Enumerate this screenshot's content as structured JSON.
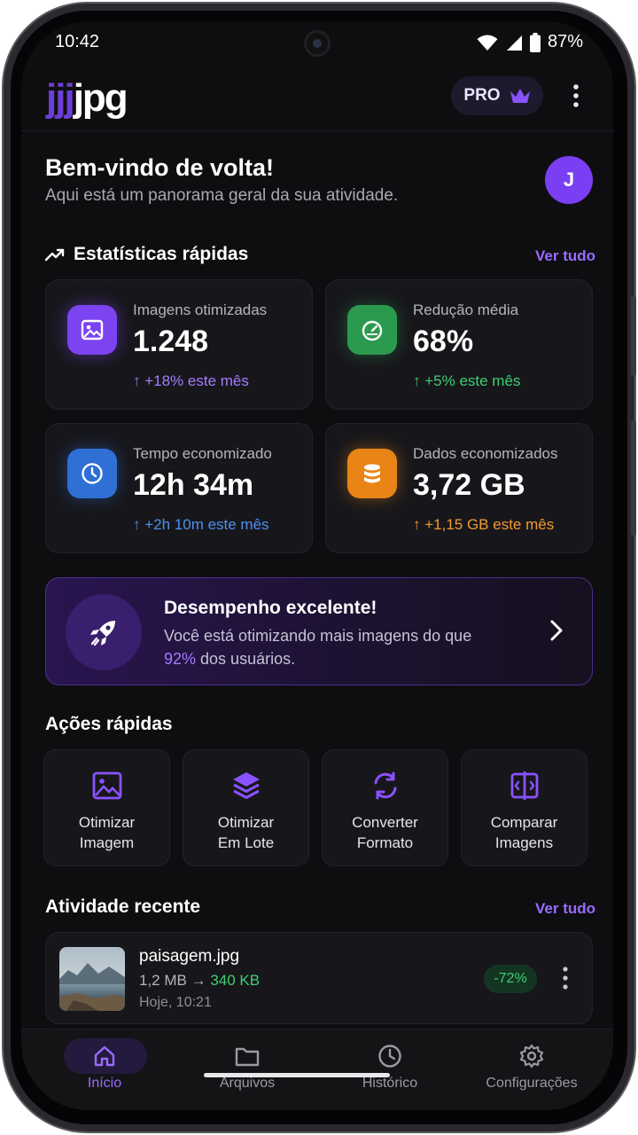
{
  "status": {
    "time": "10:42",
    "battery": "87%"
  },
  "header": {
    "logo_prefix": "jjj",
    "logo_suffix": "jpg",
    "pro_label": "PRO"
  },
  "welcome": {
    "title": "Bem-vindo de volta!",
    "subtitle": "Aqui está um panorama geral da sua atividade.",
    "avatar_initial": "J"
  },
  "quick_stats": {
    "title": "Estatísticas rápidas",
    "see_all": "Ver tudo",
    "cards": [
      {
        "label": "Imagens otimizadas",
        "value": "1.248",
        "trend": "↑ +18% este mês",
        "icon": "image-icon",
        "color": "#7b44f0",
        "trend_color": "#a67aff"
      },
      {
        "label": "Redução média",
        "value": "68%",
        "trend": "↑ +5% este mês",
        "icon": "speedometer-icon",
        "color": "#2c9a4e",
        "trend_color": "#3ecf72"
      },
      {
        "label": "Tempo economizado",
        "value": "12h 34m",
        "trend": "↑ +2h 10m este mês",
        "icon": "clock-icon",
        "color": "#2f6fd6",
        "trend_color": "#4f8ff0"
      },
      {
        "label": "Dados economizados",
        "value": "3,72 GB",
        "trend": "↑ +1,15 GB este mês",
        "icon": "database-icon",
        "color": "#e98416",
        "trend_color": "#f59a2f"
      }
    ]
  },
  "performance": {
    "title": "Desempenho excelente!",
    "desc_before": "Você está otimizando mais imagens do que ",
    "highlight": "92%",
    "desc_after": " dos usuários."
  },
  "quick_actions": {
    "title": "Ações rápidas",
    "items": [
      {
        "line1": "Otimizar",
        "line2": "Imagem",
        "icon": "image-icon"
      },
      {
        "line1": "Otimizar",
        "line2": "Em Lote",
        "icon": "layers-icon"
      },
      {
        "line1": "Converter",
        "line2": "Formato",
        "icon": "convert-icon"
      },
      {
        "line1": "Comparar",
        "line2": "Imagens",
        "icon": "compare-icon"
      }
    ]
  },
  "recent": {
    "title": "Atividade recente",
    "see_all": "Ver tudo",
    "items": [
      {
        "name": "paisagem.jpg",
        "size_from": "1,2 MB",
        "arrow": "→",
        "size_to": "340 KB",
        "time": "Hoje, 10:21",
        "reduction": "-72%"
      }
    ]
  },
  "nav": {
    "items": [
      {
        "label": "Início",
        "icon": "home-icon"
      },
      {
        "label": "Arquivos",
        "icon": "folder-icon"
      },
      {
        "label": "Histórico",
        "icon": "history-icon"
      },
      {
        "label": "Configurações",
        "icon": "settings-icon"
      }
    ]
  }
}
